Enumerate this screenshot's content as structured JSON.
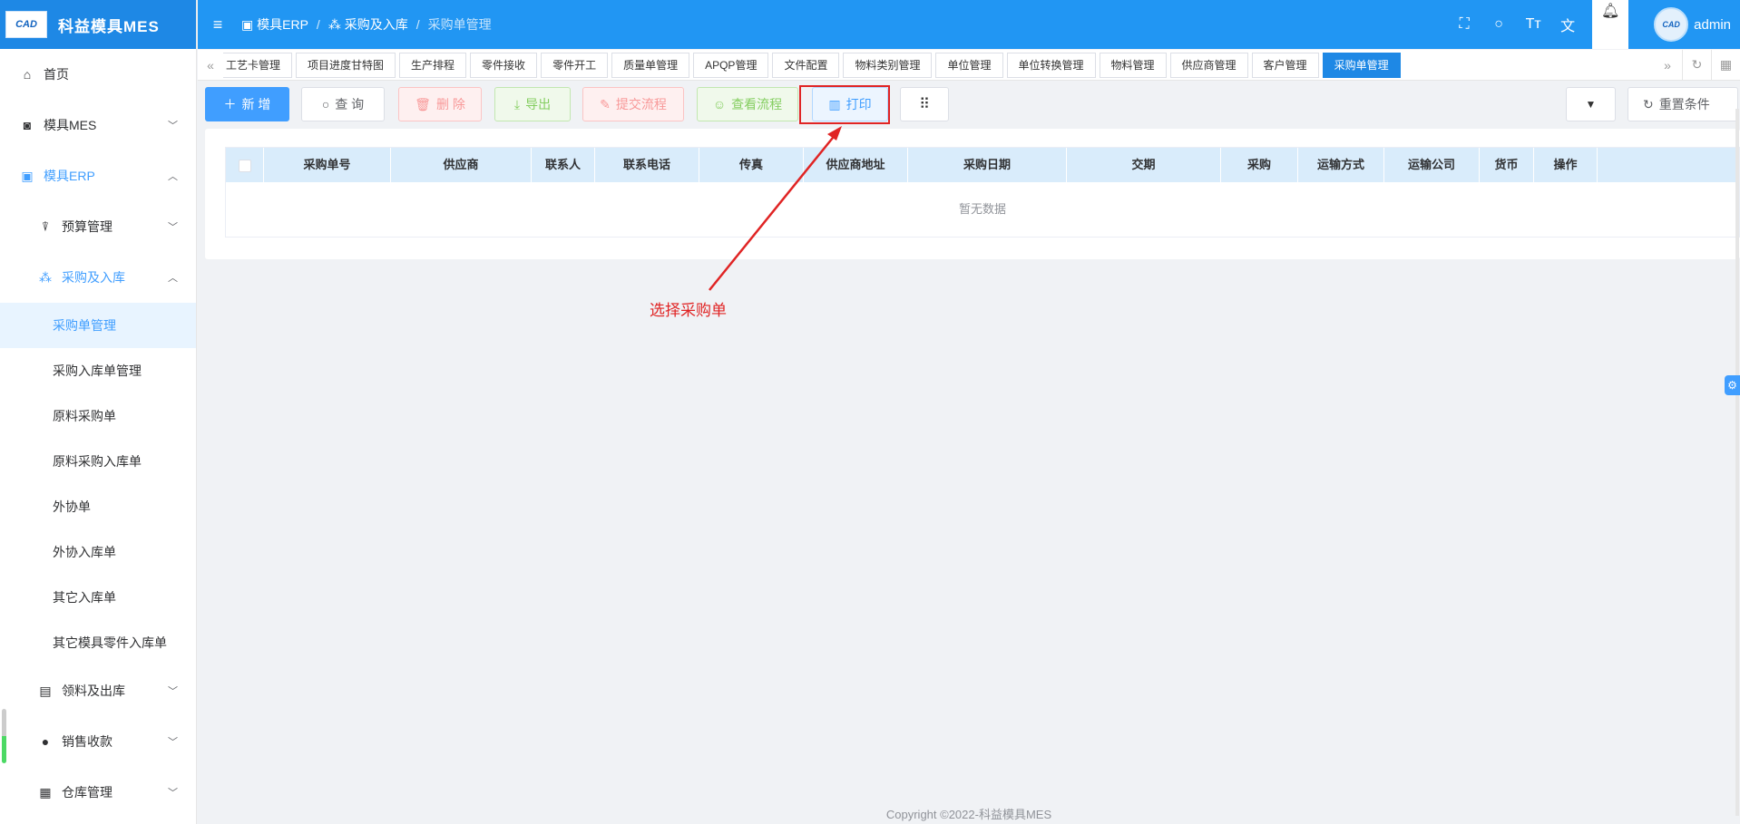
{
  "app": {
    "logo_text": "CAD",
    "title": "科益模具MES"
  },
  "sidebar": {
    "home": "首页",
    "mes": "模具MES",
    "erp": "模具ERP",
    "budget": "预算管理",
    "purchase": "采购及入库",
    "purchase_items": [
      "采购单管理",
      "采购入库单管理",
      "原料采购单",
      "原料采购入库单",
      "外协单",
      "外协入库单",
      "其它入库单",
      "其它模具零件入库单"
    ],
    "picking": "领料及出库",
    "sales": "销售收款",
    "warehouse": "仓库管理"
  },
  "header": {
    "breadcrumb": [
      "模具ERP",
      "采购及入库",
      "采购单管理"
    ],
    "username": "admin",
    "avatar_text": "CAD",
    "icons": [
      "fullscreen-icon",
      "search-icon",
      "font-size-icon",
      "translate-icon",
      "bell-icon"
    ]
  },
  "tags": [
    "工艺卡管理",
    "项目进度甘特图",
    "生产排程",
    "零件接收",
    "零件开工",
    "质量单管理",
    "APQP管理",
    "文件配置",
    "物料类别管理",
    "单位管理",
    "单位转换管理",
    "物料管理",
    "供应商管理",
    "客户管理",
    "采购单管理"
  ],
  "tags_active_index": 14,
  "toolbar": {
    "add": "新 增",
    "query": "查 询",
    "delete": "删 除",
    "export": "导出",
    "submit": "提交流程",
    "view_flow": "查看流程",
    "print": "打印",
    "reset": "重置条件"
  },
  "table": {
    "columns": [
      "采购单号",
      "供应商",
      "联系人",
      "联系电话",
      "传真",
      "供应商地址",
      "采购日期",
      "交期",
      "采购",
      "运输方式",
      "运输公司",
      "货币",
      "操作"
    ],
    "empty_text": "暂无数据"
  },
  "annotation": {
    "text": "选择采购单",
    "color": "#e02424"
  },
  "footer": "Copyright ©2022-科益模具MES",
  "colors": {
    "primary": "#2196f3",
    "accent": "#409eff",
    "danger": "#f89898",
    "success": "#85ce61"
  }
}
